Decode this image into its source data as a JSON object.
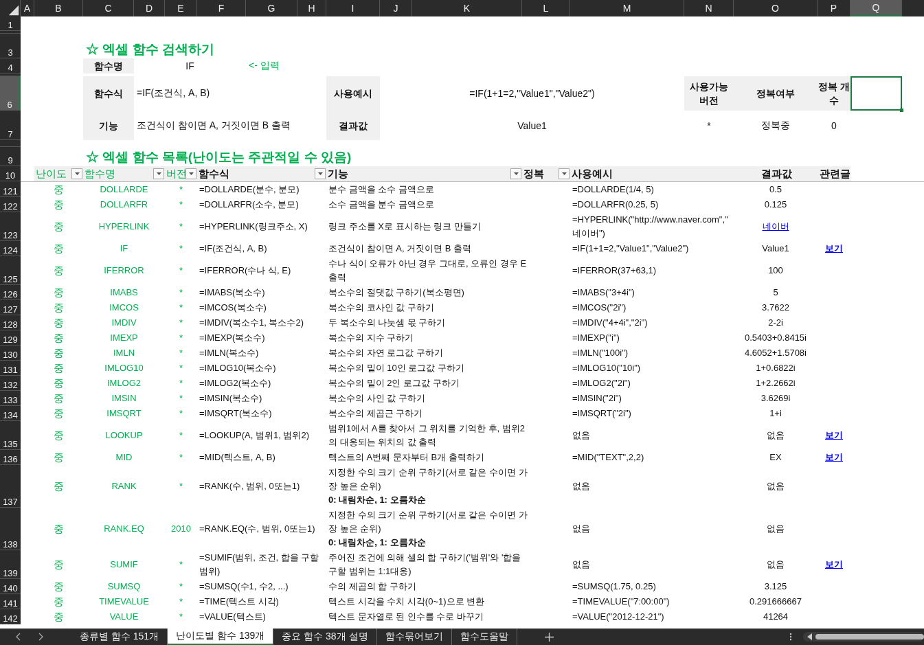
{
  "columns": [
    {
      "label": "A",
      "selected": false
    },
    {
      "label": "B",
      "selected": false
    },
    {
      "label": "C",
      "selected": false
    },
    {
      "label": "D",
      "selected": false
    },
    {
      "label": "E",
      "selected": false
    },
    {
      "label": "F",
      "selected": false
    },
    {
      "label": "G",
      "selected": false
    },
    {
      "label": "H",
      "selected": false
    },
    {
      "label": "I",
      "selected": false
    },
    {
      "label": "J",
      "selected": false
    },
    {
      "label": "K",
      "selected": false
    },
    {
      "label": "L",
      "selected": false
    },
    {
      "label": "M",
      "selected": false
    },
    {
      "label": "N",
      "selected": false
    },
    {
      "label": "O",
      "selected": false
    },
    {
      "label": "P",
      "selected": false
    },
    {
      "label": "Q",
      "selected": true
    }
  ],
  "row_headers": [
    {
      "label": "1",
      "selected": false
    },
    {
      "label": "3",
      "selected": false
    },
    {
      "label": "4",
      "selected": false
    },
    {
      "label": "6",
      "selected": true
    },
    {
      "label": "7",
      "selected": false
    },
    {
      "label": "9",
      "selected": false
    },
    {
      "label": "10",
      "selected": false
    }
  ],
  "search": {
    "title": "☆ 엑셀 함수 검색하기",
    "name_label": "함수명",
    "name_value": "IF",
    "input_hint": "<- 입력",
    "formula_label": "함수식",
    "formula_value": "=IF(조건식, A, B)",
    "function_label": "기능",
    "function_value": "조건식이 참이면 A, 거짓이면 B 출력",
    "example_label": "사용예시",
    "example_value": "=IF(1+1=2,\"Value1\",\"Value2\")",
    "result_label": "결과값",
    "result_value": "Value1",
    "version_label": "사용가능 버전",
    "version_value": "*",
    "status_label": "정복여부",
    "status_value": "정복중",
    "count_label": "정복 개수",
    "count_value": "0"
  },
  "list_title": "☆ 엑셀 함수 목록(난이도는 주관적일 수 있음)",
  "headers": [
    {
      "label": "난이도",
      "kind": "accent",
      "filter": true
    },
    {
      "label": "함수명",
      "kind": "accent",
      "filter": true
    },
    {
      "label": "버전",
      "kind": "accent",
      "filter": true
    },
    {
      "label": "함수식",
      "kind": "plain",
      "filter": true
    },
    {
      "label": "기능",
      "kind": "plain",
      "filter": true
    },
    {
      "label": "정복",
      "kind": "plain",
      "filter": true
    },
    {
      "label": "사용예시",
      "kind": "plain",
      "filter": false
    },
    {
      "label": "결과값",
      "kind": "plain",
      "filter": false
    },
    {
      "label": "관련글",
      "kind": "plain",
      "filter": false
    }
  ],
  "rows": [
    {
      "num": "121",
      "level": "중",
      "name": "DOLLARDE",
      "version": "*",
      "formula": "=DOLLARDE(분수, 분모)",
      "description": "분수 금액을 소수 금액으로",
      "example": "=DOLLARDE(1/4, 5)",
      "result": "0.5",
      "result_link": false
    },
    {
      "num": "122",
      "level": "중",
      "name": "DOLLARFR",
      "version": "*",
      "formula": "=DOLLARFR(소수, 분모)",
      "description": "소수 금액을 분수 금액으로",
      "example": "=DOLLARFR(0.25, 5)",
      "result": "0.125",
      "result_link": false
    },
    {
      "num": "123",
      "level": "중",
      "name": "HYPERLINK",
      "version": "*",
      "formula": "=HYPERLINK(링크주소, X)",
      "description": "링크 주소를 X로 표시하는 링크 만들기",
      "example": "=HYPERLINK(\"http://www.naver.com\",\"네이버\")",
      "result": "네이버",
      "result_link": true
    },
    {
      "num": "124",
      "level": "중",
      "name": "IF",
      "version": "*",
      "formula": "=IF(조건식, A, B)",
      "description": "조건식이 참이면 A, 거짓이면 B 출력",
      "example": "=IF(1+1=2,\"Value1\",\"Value2\")",
      "result": "Value1",
      "result_link": false,
      "related": "보기"
    },
    {
      "num": "125",
      "level": "중",
      "name": "IFERROR",
      "version": "*",
      "formula": "=IFERROR(수나 식, E)",
      "description": "수나 식이 오류가 아닌 경우 그대로, 오류인 경우 E 출력",
      "example": "=IFERROR(37+63,1)",
      "result": "100",
      "result_link": false
    },
    {
      "num": "126",
      "level": "중",
      "name": "IMABS",
      "version": "*",
      "formula": "=IMABS(복소수)",
      "description": "복소수의 절댓값 구하기(복소평면)",
      "example": "=IMABS(\"3+4i\")",
      "result": "5",
      "result_link": false
    },
    {
      "num": "127",
      "level": "중",
      "name": "IMCOS",
      "version": "*",
      "formula": "=IMCOS(복소수)",
      "description": "복소수의 코사인 값 구하기",
      "example": "=IMCOS(\"2i\")",
      "result": "3.7622",
      "result_link": false
    },
    {
      "num": "128",
      "level": "중",
      "name": "IMDIV",
      "version": "*",
      "formula": "=IMDIV(복소수1, 복소수2)",
      "description": "두 복소수의 나눗셈 몫 구하기",
      "example": "=IMDIV(\"4+4i\",\"2i\")",
      "result": "2-2i",
      "result_link": false
    },
    {
      "num": "129",
      "level": "중",
      "name": "IMEXP",
      "version": "*",
      "formula": "=IMEXP(복소수)",
      "description": "복소수의 지수 구하기",
      "example": "=IMEXP(\"i\")",
      "result": "0.5403+0.8415i",
      "result_link": false
    },
    {
      "num": "130",
      "level": "중",
      "name": "IMLN",
      "version": "*",
      "formula": "=IMLN(복소수)",
      "description": "복소수의 자연 로그값 구하기",
      "example": "=IMLN(\"100i\")",
      "result": "4.6052+1.5708i",
      "result_link": false
    },
    {
      "num": "131",
      "level": "중",
      "name": "IMLOG10",
      "version": "*",
      "formula": "=IMLOG10(복소수)",
      "description": "복소수의 밑이 10인 로그값 구하기",
      "example": "=IMLOG10(\"10i\")",
      "result": "1+0.6822i",
      "result_link": false
    },
    {
      "num": "132",
      "level": "중",
      "name": "IMLOG2",
      "version": "*",
      "formula": "=IMLOG2(복소수)",
      "description": "복소수의 밑이 2인 로그값 구하기",
      "example": "=IMLOG2(\"2i\")",
      "result": "1+2.2662i",
      "result_link": false
    },
    {
      "num": "133",
      "level": "중",
      "name": "IMSIN",
      "version": "*",
      "formula": "=IMSIN(복소수)",
      "description": "복소수의 사인 값 구하기",
      "example": "=IMSIN(\"2i\")",
      "result": "3.6269i",
      "result_link": false
    },
    {
      "num": "134",
      "level": "중",
      "name": "IMSQRT",
      "version": "*",
      "formula": "=IMSQRT(복소수)",
      "description": "복소수의 제곱근 구하기",
      "example": "=IMSQRT(\"2i\")",
      "result": "1+i",
      "result_link": false
    },
    {
      "num": "135",
      "level": "중",
      "name": "LOOKUP",
      "version": "*",
      "formula": "=LOOKUP(A, 범위1, 범위2)",
      "description": "범위1에서 A를 찾아서 그 위치를 기억한 후, 범위2의 대응되는 위치의 값 출력",
      "example": "없음",
      "result": "없음",
      "result_link": false,
      "related": "보기"
    },
    {
      "num": "136",
      "level": "중",
      "name": "MID",
      "version": "*",
      "formula": "=MID(텍스트, A, B)",
      "description": "텍스트의 A번째 문자부터 B개 출력하기",
      "example": "=MID(\"TEXT\",2,2)",
      "result": "EX",
      "result_link": false,
      "related": "보기"
    },
    {
      "num": "137",
      "level": "중",
      "name": "RANK",
      "version": "*",
      "formula": "=RANK(수, 범위, 0또는1)",
      "description": "지정한 수의 크기 순위 구하기(서로 같은 수이면 가장 높은 순위)",
      "note": "0: 내림차순, 1: 오름차순",
      "example": "없음",
      "result": "없음",
      "result_link": false
    },
    {
      "num": "138",
      "level": "중",
      "name": "RANK.EQ",
      "version": "2010",
      "formula": "=RANK.EQ(수, 범위, 0또는1)",
      "description": "지정한 수의 크기 순위 구하기(서로 같은 수이면 가장 높은 순위)",
      "note": "0: 내림차순, 1: 오름차순",
      "example": "없음",
      "result": "없음",
      "result_link": false
    },
    {
      "num": "139",
      "level": "중",
      "name": "SUMIF",
      "version": "*",
      "formula": "=SUMIF(범위, 조건, 합을 구할 범위)",
      "description": "주어진 조건에 의해 셀의 합 구하기('범위'와 '합을 구할 범위는 1:1대응)",
      "example": "없음",
      "result": "없음",
      "result_link": false,
      "related": "보기"
    },
    {
      "num": "140",
      "level": "중",
      "name": "SUMSQ",
      "version": "*",
      "formula": "=SUMSQ(수1, 수2, ...)",
      "description": "수의 제곱의 합 구하기",
      "example": "=SUMSQ(1.75, 0.25)",
      "result": "3.125",
      "result_link": false
    },
    {
      "num": "141",
      "level": "중",
      "name": "TIMEVALUE",
      "version": "*",
      "formula": "=TIME(텍스트 시각)",
      "description": "텍스트 시각을 수치 시각(0~1)으로 변환",
      "example": "=TIMEVALUE(\"7:00:00\")",
      "result": "0.291666667",
      "result_link": false
    },
    {
      "num": "142",
      "level": "중",
      "name": "VALUE",
      "version": "*",
      "formula": "=VALUE(텍스트)",
      "description": "텍스트 문자열로 된 인수를 수로 바꾸기",
      "example": "=VALUE(\"2012-12-21\")",
      "result": "41264",
      "result_link": false
    }
  ],
  "sheet_tabs": [
    {
      "label": "종류별 함수 151개",
      "selected": false
    },
    {
      "label": "난이도별 함수 139개",
      "selected": true
    },
    {
      "label": "중요 함수 38개 설명",
      "selected": false
    },
    {
      "label": "함수묶어보기",
      "selected": false
    },
    {
      "label": "함수도움말",
      "selected": false
    }
  ]
}
